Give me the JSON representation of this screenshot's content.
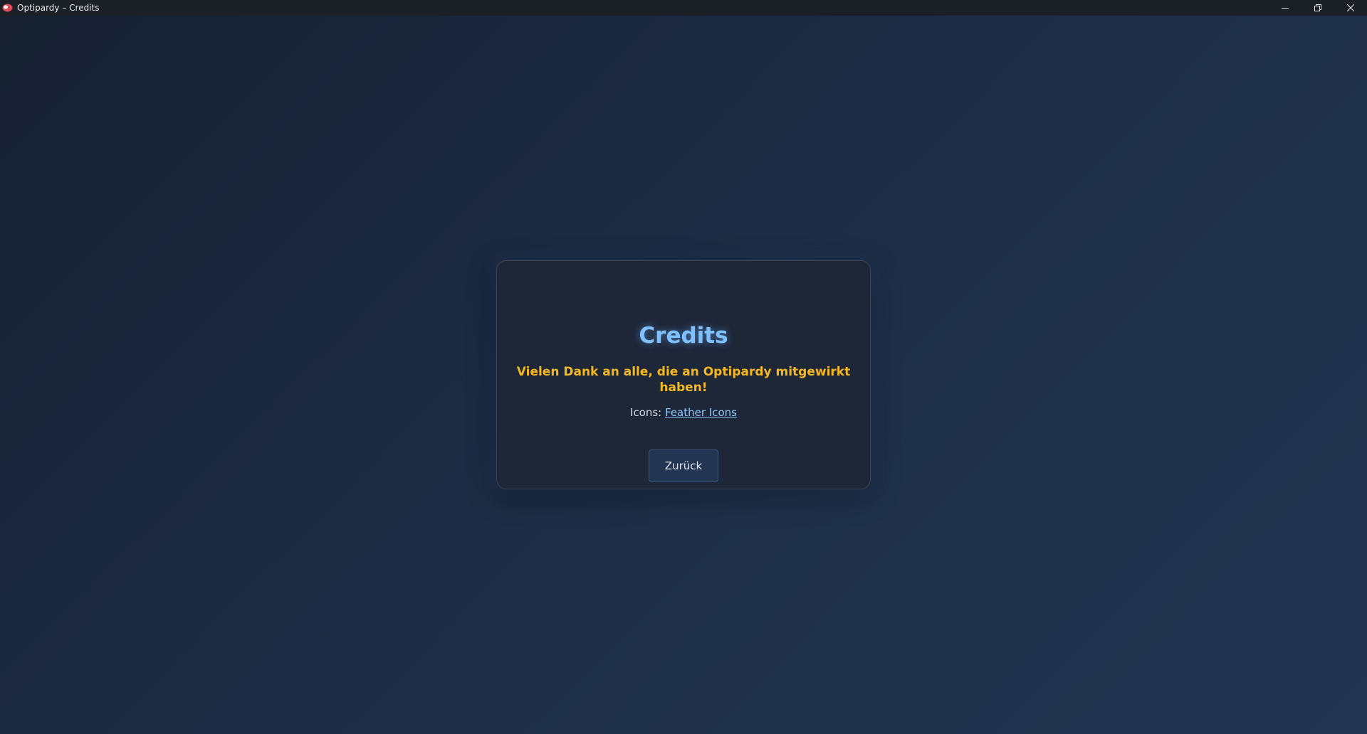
{
  "window": {
    "title": "Optipardy – Credits",
    "controls": {
      "minimize": "minimize-icon",
      "restore": "restore-icon",
      "close": "close-icon"
    }
  },
  "credits": {
    "title": "Credits",
    "subtitle": "Vielen Dank an alle, die an Optipardy mitgewirkt haben!",
    "icons_label": "Icons:",
    "icons_link": "Feather Icons",
    "back_button": "Zurück"
  },
  "colors": {
    "title": "#7fc0ff",
    "subtitle": "#f5b820",
    "link": "#8ec9ff",
    "card_background": "#1e2738",
    "titlebar": "#1b1f26"
  }
}
